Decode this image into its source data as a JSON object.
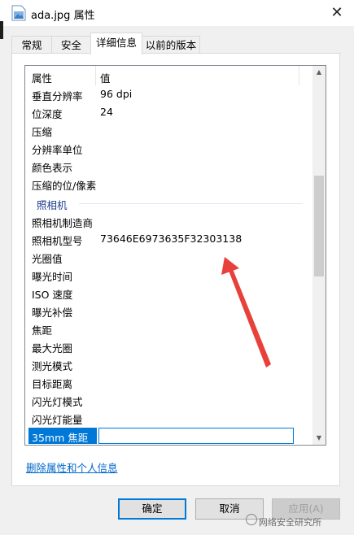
{
  "window": {
    "title": "ada.jpg 属性",
    "close_glyph": "✕"
  },
  "tabs": [
    {
      "label": "常规"
    },
    {
      "label": "安全"
    },
    {
      "label": "详细信息"
    },
    {
      "label": "以前的版本"
    }
  ],
  "table": {
    "col_property": "属性",
    "col_value": "值",
    "rows": [
      {
        "key": "垂直分辨率",
        "value": "96 dpi"
      },
      {
        "key": "位深度",
        "value": "24"
      },
      {
        "key": "压缩",
        "value": ""
      },
      {
        "key": "分辨率单位",
        "value": ""
      },
      {
        "key": "颜色表示",
        "value": ""
      },
      {
        "key": "压缩的位/像素",
        "value": ""
      }
    ],
    "group_camera": "照相机",
    "camera_rows": [
      {
        "key": "照相机制造商",
        "value": ""
      },
      {
        "key": "照相机型号",
        "value": "73646E6973635F32303138"
      },
      {
        "key": "光圈值",
        "value": ""
      },
      {
        "key": "曝光时间",
        "value": ""
      },
      {
        "key": "ISO 速度",
        "value": ""
      },
      {
        "key": "曝光补偿",
        "value": ""
      },
      {
        "key": "焦距",
        "value": ""
      },
      {
        "key": "最大光圈",
        "value": ""
      },
      {
        "key": "测光模式",
        "value": ""
      },
      {
        "key": "目标距离",
        "value": ""
      },
      {
        "key": "闪光灯模式",
        "value": ""
      },
      {
        "key": "闪光灯能量",
        "value": ""
      }
    ],
    "selected_row": {
      "key": "35mm 焦距",
      "value": ""
    }
  },
  "link": {
    "label": "删除属性和个人信息"
  },
  "buttons": {
    "ok": "确定",
    "cancel": "取消",
    "apply": "应用(A)"
  },
  "watermark": {
    "text": "网络安全研究所"
  },
  "colors": {
    "accent": "#0078d7",
    "annotation_arrow": "#e8403a",
    "link": "#0066cc"
  },
  "icons": {
    "file": "image-file-icon",
    "close": "close-icon",
    "scroll_up": "scroll-up-icon",
    "scroll_down": "scroll-down-icon"
  }
}
